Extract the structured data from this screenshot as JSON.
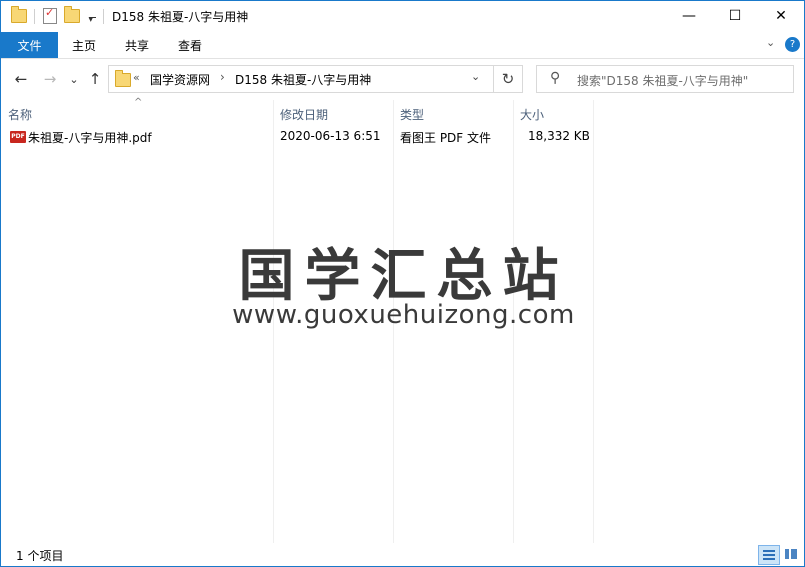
{
  "window": {
    "title": "D158 朱祖夏-八字与用神",
    "controls": {
      "minimize": "—",
      "maximize": "☐",
      "close": "✕"
    }
  },
  "ribbon": {
    "file_tab": "文件",
    "tabs": [
      "主页",
      "共享",
      "查看"
    ],
    "expand_icon": "chevron-down-icon",
    "help_label": "?"
  },
  "navigation": {
    "back": "←",
    "forward": "→",
    "recent": "⌄",
    "up": "↑",
    "address_overflow": "«",
    "address_segments": [
      "国学资源网",
      "D158 朱祖夏-八字与用神"
    ],
    "address_separator": "›",
    "address_dropdown": "⌄",
    "refresh": "↻",
    "search_placeholder": "搜索\"D158 朱祖夏-八字与用神\""
  },
  "file_list": {
    "columns": [
      "名称",
      "修改日期",
      "类型",
      "大小"
    ],
    "sort_indicator": "^",
    "rows": [
      {
        "icon": "pdf-icon",
        "icon_text": "PDF",
        "name": "朱祖夏-八字与用神.pdf",
        "modified": "2020-06-13 6:51",
        "type": "看图王 PDF 文件",
        "size": "18,332 KB"
      }
    ]
  },
  "watermark": {
    "title": "国学汇总站",
    "url": "www.guoxuehuizong.com"
  },
  "status_bar": {
    "item_count": "1 个项目"
  },
  "colors": {
    "accent": "#1979ca",
    "header_text": "#4c607a",
    "pdf_icon": "#c8271f"
  }
}
